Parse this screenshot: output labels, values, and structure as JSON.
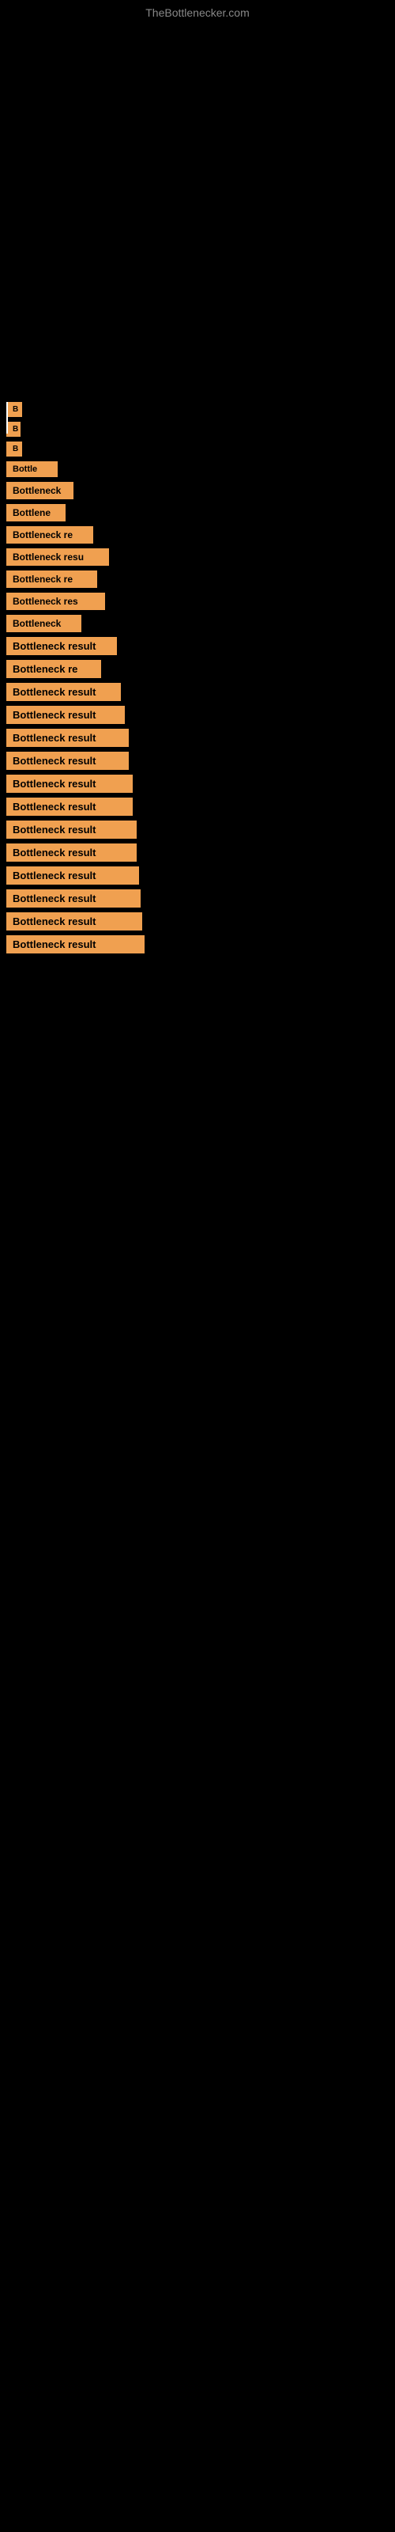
{
  "header": {
    "site_title": "TheBottlenecker.com"
  },
  "items": [
    {
      "id": 1,
      "label": "B"
    },
    {
      "id": 2,
      "label": "B"
    },
    {
      "id": 3,
      "label": "B"
    },
    {
      "id": 4,
      "label": "Bottle"
    },
    {
      "id": 5,
      "label": "Bottleneck"
    },
    {
      "id": 6,
      "label": "Bottlene"
    },
    {
      "id": 7,
      "label": "Bottleneck re"
    },
    {
      "id": 8,
      "label": "Bottleneck resu"
    },
    {
      "id": 9,
      "label": "Bottleneck re"
    },
    {
      "id": 10,
      "label": "Bottleneck res"
    },
    {
      "id": 11,
      "label": "Bottleneck"
    },
    {
      "id": 12,
      "label": "Bottleneck result"
    },
    {
      "id": 13,
      "label": "Bottleneck re"
    },
    {
      "id": 14,
      "label": "Bottleneck result"
    },
    {
      "id": 15,
      "label": "Bottleneck result"
    },
    {
      "id": 16,
      "label": "Bottleneck result"
    },
    {
      "id": 17,
      "label": "Bottleneck result"
    },
    {
      "id": 18,
      "label": "Bottleneck result"
    },
    {
      "id": 19,
      "label": "Bottleneck result"
    },
    {
      "id": 20,
      "label": "Bottleneck result"
    },
    {
      "id": 21,
      "label": "Bottleneck result"
    },
    {
      "id": 22,
      "label": "Bottleneck result"
    },
    {
      "id": 23,
      "label": "Bottleneck result"
    },
    {
      "id": 24,
      "label": "Bottleneck result"
    },
    {
      "id": 25,
      "label": "Bottleneck result"
    }
  ]
}
